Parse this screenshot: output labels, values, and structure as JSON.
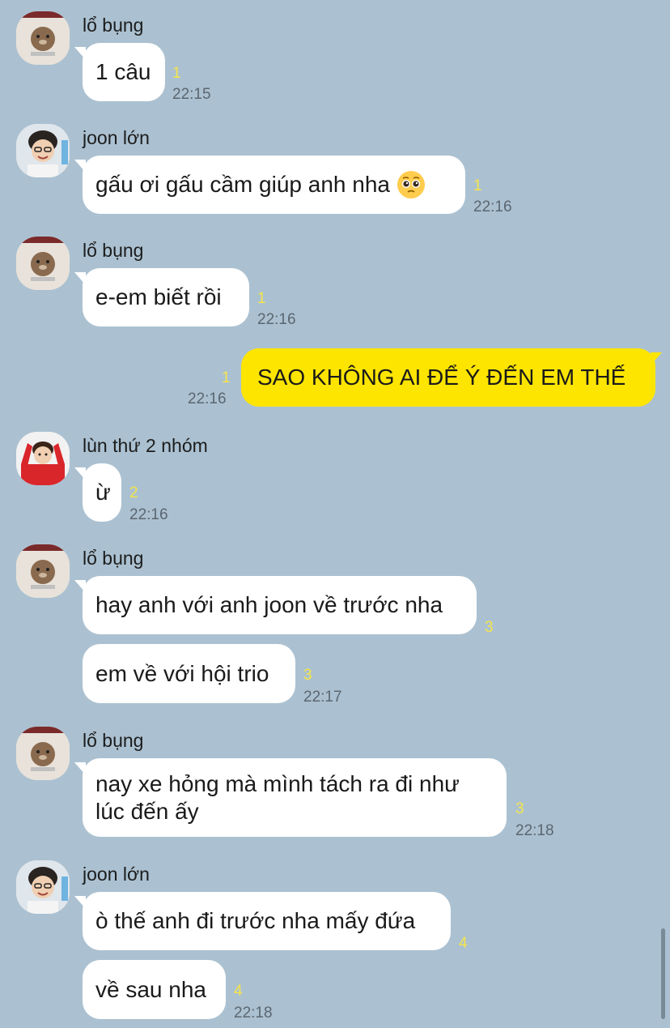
{
  "colors": {
    "background": "#abc1d1",
    "bubble_incoming": "#ffffff",
    "bubble_outgoing": "#fee500",
    "unread_count": "#f5e44a",
    "timestamp": "#5b6670"
  },
  "senders": {
    "lo_bung": "lổ bụng",
    "joon_lon": "joon lớn",
    "lun_thu_2": "lùn thứ 2 nhóm"
  },
  "messages": [
    {
      "text": "1 câu",
      "unread": "1",
      "time": "22:15"
    },
    {
      "text": "gấu ơi gấu cầm giúp anh nha",
      "emoji": "pleading-face-icon",
      "unread": "1",
      "time": "22:16"
    },
    {
      "text": "e-em biết rồi",
      "unread": "1",
      "time": "22:16"
    },
    {
      "text": "SAO KHÔNG AI ĐỂ Ý ĐẾN EM THẾ",
      "unread": "1",
      "time": "22:16"
    },
    {
      "text": "ừ",
      "unread": "2",
      "time": "22:16"
    },
    {
      "text": "hay anh với anh joon về trước nha",
      "unread": "3"
    },
    {
      "text": "em về với hội trio",
      "unread": "3",
      "time": "22:17"
    },
    {
      "text": "nay xe hỏng mà mình tách ra đi như lúc đến ấy",
      "unread": "3",
      "time": "22:18"
    },
    {
      "text": "ò thế anh đi trước nha mấy đứa",
      "unread": "4"
    },
    {
      "text": "về sau nha",
      "unread": "4",
      "time": "22:18"
    }
  ]
}
